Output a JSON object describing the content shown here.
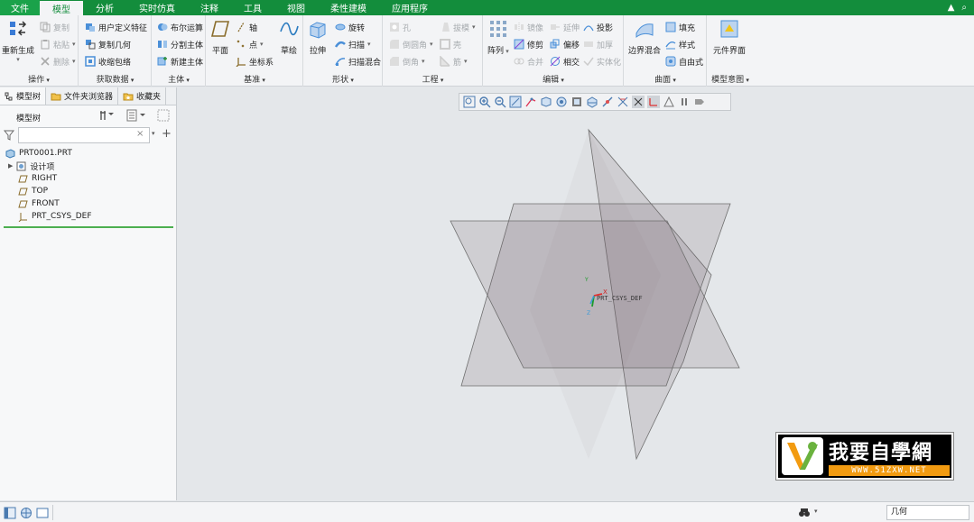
{
  "menu": {
    "file": "文件",
    "tabs": [
      "模型",
      "分析",
      "实时仿真",
      "注释",
      "工具",
      "视图",
      "柔性建模",
      "应用程序"
    ],
    "active_index": 0
  },
  "ribbon": {
    "ops": {
      "label": "操作",
      "regen": "重新生成",
      "copy": "复制",
      "paste": "粘贴",
      "delete": "删除"
    },
    "getdata": {
      "label": "获取数据",
      "udf": "用户定义特征",
      "copygeom": "复制几何",
      "shrinkwrap": "收缩包络"
    },
    "body": {
      "label": "主体",
      "boolean": "布尔运算",
      "split": "分割主体",
      "newbody": "新建主体"
    },
    "datum": {
      "label": "基准",
      "plane": "平面",
      "axis": "轴",
      "point": "点",
      "csys": "坐标系",
      "sketch": "草绘"
    },
    "shapes": {
      "label": "形状",
      "extrude": "拉伸",
      "revolve": "旋转",
      "sweep": "扫描",
      "sweptblend": "扫描混合"
    },
    "eng": {
      "label": "工程",
      "hole": "孔",
      "round": "倒圆角",
      "chamfer": "倒角",
      "draft": "拔模",
      "shell": "壳",
      "rib": "筋"
    },
    "edit": {
      "label": "编辑",
      "pattern": "阵列",
      "mirror": "镜像",
      "trim": "修剪",
      "merge": "合并",
      "extend": "延伸",
      "offset": "偏移",
      "intersect": "相交",
      "project": "投影",
      "thicken": "加厚",
      "solidify": "实体化"
    },
    "surfaces": {
      "label": "曲面",
      "boundary": "边界混合",
      "fill": "填充",
      "style": "样式",
      "freestyle": "自由式"
    },
    "intent": {
      "label": "模型意图",
      "component_interface": "元件界面"
    }
  },
  "panel": {
    "tabs": [
      "模型树",
      "文件夹浏览器",
      "收藏夹"
    ],
    "tree_title": "模型树",
    "filter_placeholder": "",
    "tree": [
      {
        "label": "PRT0001.PRT",
        "icon": "part-icon"
      },
      {
        "label": "设计项",
        "icon": "design-items-icon"
      },
      {
        "label": "RIGHT",
        "icon": "datum-plane-icon"
      },
      {
        "label": "TOP",
        "icon": "datum-plane-icon"
      },
      {
        "label": "FRONT",
        "icon": "datum-plane-icon"
      },
      {
        "label": "PRT_CSYS_DEF",
        "icon": "csys-icon"
      }
    ]
  },
  "graphics": {
    "csys_label": "PRT_CSYS_DEF",
    "axis_x": "X",
    "axis_y": "Y",
    "axis_z": "Z"
  },
  "logo": {
    "text": "我要自學網",
    "url": "WWW.51ZXW.NET"
  },
  "status": {
    "filter_value": "几何"
  },
  "colors": {
    "menu_green": "#138d3c",
    "accent_green": "#4caf50",
    "logo_orange": "#f29b11"
  }
}
